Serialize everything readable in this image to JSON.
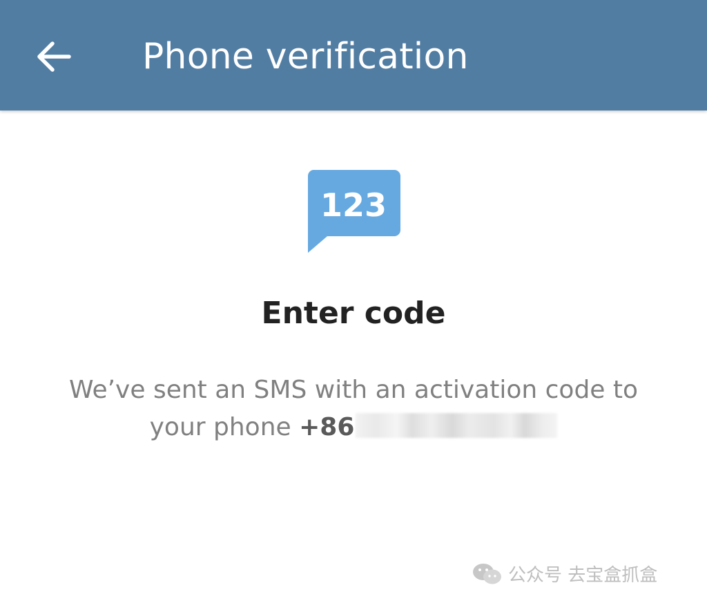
{
  "header": {
    "title": "Phone verification",
    "back_icon": "arrow-left-icon",
    "background_color": "#527da3"
  },
  "icon": {
    "name": "sms-code-icon",
    "text": "123",
    "color": "#66a9e0"
  },
  "main": {
    "heading": "Enter code",
    "description_line1": "We’ve sent an SMS with an activation code to",
    "description_line2_prefix": "your phone",
    "phone_prefix": "+86"
  },
  "watermark": {
    "icon": "wechat-icon",
    "text": "公众号 去宝盒抓盒"
  }
}
